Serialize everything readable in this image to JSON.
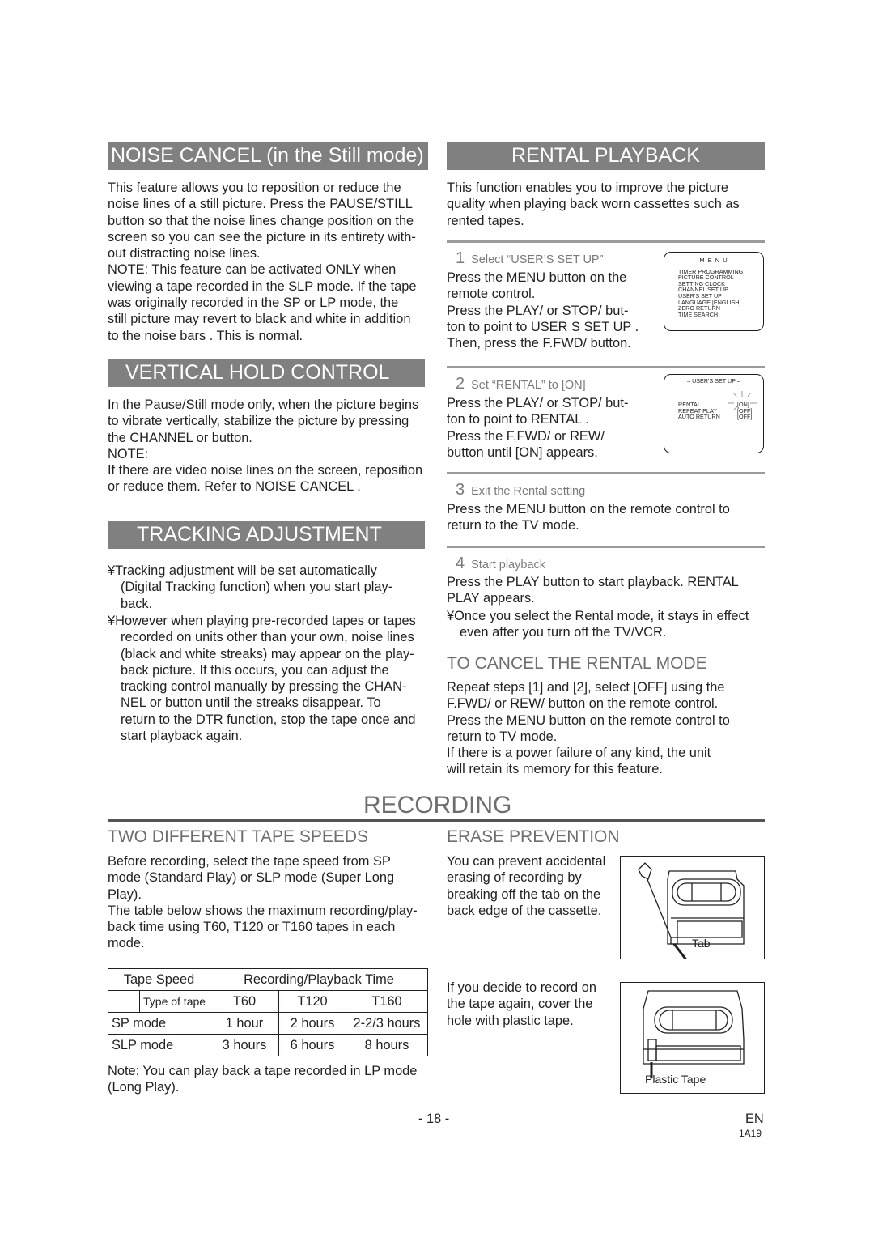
{
  "noise_cancel": {
    "heading": "NOISE CANCEL  (in the Still mode)",
    "body": "This feature allows you to reposition or reduce the\nnoise lines of a still picture. Press the PAUSE/STILL\nbutton so that the noise lines change position on the\nscreen so you can see the picture in its entirety with-\nout distracting noise lines.\nNOTE: This feature can be activated ONLY when\nviewing a tape recorded in the SLP mode. If the tape\nwas originally recorded in the SP or LP mode, the\nstill picture may revert to black and white in addition\nto the  noise bars . This is normal."
  },
  "vertical_hold": {
    "heading": "VERTICAL HOLD CONTROL",
    "body": "In the Pause/Still mode only, when the picture begins\nto vibrate vertically, stabilize the picture by pressing\nthe CHANNEL     or     button.\nNOTE:\nIf there are video noise lines on the screen, reposition\nor reduce them. Refer to  NOISE CANCEL ."
  },
  "tracking": {
    "heading": "TRACKING ADJUSTMENT",
    "bullet_glyph": "¥",
    "bullets": [
      "Tracking adjustment will be set automatically\n(Digital Tracking function) when you start play-\nback.",
      "However when playing pre-recorded tapes or tapes\nrecorded on units other than your own, noise lines\n(black and white streaks) may appear on the play-\nback picture. If this occurs, you can adjust the\ntracking control manually by pressing the CHAN-\nNEL     or     button until the streaks disappear. To\nreturn to the DTR function, stop the tape once and\nstart playback again."
    ]
  },
  "rental": {
    "heading": "RENTAL PLAYBACK",
    "intro": "This function enables you to improve the picture\nquality when playing back worn cassettes such as\nrented tapes.",
    "steps": [
      {
        "num": "1",
        "title": "Select “USER’S SET UP”",
        "body": "Press the MENU button on the\nremote control.\nPress the PLAY/  or STOP/   but-\nton to point to  USER S SET UP .\nThen, press the F.FWD/ button."
      },
      {
        "num": "2",
        "title": "Set “RENTAL” to [ON]",
        "body": "Press the PLAY/  or STOP/   but-\nton to point to  RENTAL .\nPress the F.FWD/  or REW/\nbutton until [ON] appears."
      },
      {
        "num": "3",
        "title": "Exit the Rental setting",
        "body": "Press the MENU button on the remote control to\nreturn to the TV mode."
      },
      {
        "num": "4",
        "title": "Start playback",
        "body": "Press the PLAY button to start playback.  RENTAL\nPLAY       appears."
      }
    ],
    "note": "Once you select the Rental mode, it stays in effect\neven after you turn off the TV/VCR.",
    "menu_screen": {
      "title": "– M E N U –",
      "items": [
        "TIMER PROGRAMMING",
        "PICTURE CONTROL",
        "SETTING CLOCK",
        "CHANNEL SET UP",
        "USER'S SET UP",
        "LANGUAGE  [ENGLISH]",
        "ZERO RETURN",
        "TIME SEARCH"
      ]
    },
    "users_screen": {
      "title": "– USER'S SET UP –",
      "rows": [
        {
          "label": "RENTAL",
          "value": "[ON]"
        },
        {
          "label": "REPEAT PLAY",
          "value": "[OFF]"
        },
        {
          "label": "AUTO RETURN",
          "value": "[OFF]"
        }
      ]
    },
    "cancel_heading": "TO CANCEL THE RENTAL MODE",
    "cancel_body": "Repeat steps [1] and [2], select [OFF] using the\nF.FWD/    or REW/    button on the remote control.\nPress the MENU button on the remote control to\nreturn to TV mode.\nIf there is a power failure of any kind, the unit\nwill retain its memory for this feature."
  },
  "recording": {
    "heading": "RECORDING",
    "speeds_heading": "TWO DIFFERENT TAPE SPEEDS",
    "speeds_body": "Before recording, select the tape speed from SP\nmode (Standard Play) or SLP mode (Super Long\nPlay).\nThe table below shows the maximum recording/play-\nback time using T60, T120 or T160 tapes in each\nmode.",
    "table": {
      "header1": [
        "Tape Speed",
        "Recording/Playback Time"
      ],
      "header2": [
        "Type of tape",
        "T60",
        "T120",
        "T160"
      ],
      "rows": [
        [
          "SP mode",
          "1 hour",
          "2 hours",
          "2-2/3 hours"
        ],
        [
          "SLP mode",
          "3 hours",
          "6 hours",
          "8 hours"
        ]
      ]
    },
    "table_note": "Note: You can play back a tape recorded in LP mode\n(Long Play).",
    "erase_heading": "ERASE PREVENTION",
    "erase_body": "You can prevent accidental\nerasing of recording by\nbreaking off the tab on the\nback edge of the cassette.",
    "erase_fig_label": "Tab",
    "record_again_body": "If you decide to record on\nthe tape again, cover the\nhole with plastic tape.",
    "record_again_fig_label": "Plastic Tape"
  },
  "footer": {
    "page_number": "- 18 -",
    "lang": "EN",
    "code": "1A19"
  }
}
